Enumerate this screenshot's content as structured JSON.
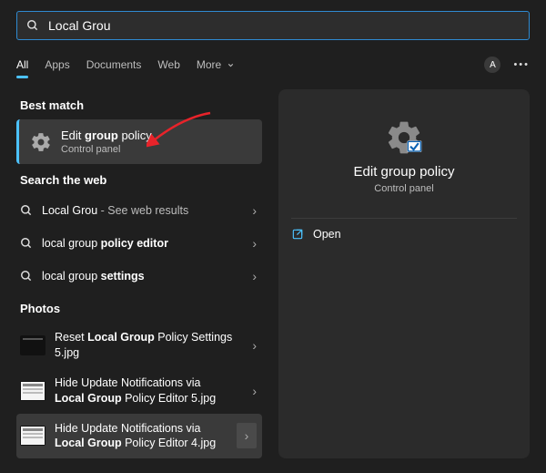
{
  "search": {
    "value": "Local Grou"
  },
  "tabs": {
    "all": "All",
    "apps": "Apps",
    "documents": "Documents",
    "web": "Web",
    "more": "More"
  },
  "avatar_letter": "A",
  "sections": {
    "best_match": "Best match",
    "search_web": "Search the web",
    "photos": "Photos"
  },
  "best_match": {
    "title_pre": "Edit ",
    "title_bold": "group",
    "title_post": " policy",
    "subtitle": "Control panel"
  },
  "web_results": [
    {
      "pre": "Local Grou",
      "bold": "",
      "post": "",
      "suffix": " - See web results"
    },
    {
      "pre": "local group ",
      "bold": "policy editor",
      "post": "",
      "suffix": ""
    },
    {
      "pre": "local group ",
      "bold": "settings",
      "post": "",
      "suffix": ""
    }
  ],
  "photos": [
    {
      "line1_pre": "Reset ",
      "line1_bold": "Local Group",
      "line1_post": " Policy Settings",
      "line2": "5.jpg"
    },
    {
      "line1_pre": "Hide Update Notifications via",
      "line1_bold": "",
      "line1_post": "",
      "line2_pre": "",
      "line2_bold": "Local Group",
      "line2_post": " Policy Editor 5.jpg"
    },
    {
      "line1_pre": "Hide Update Notifications via",
      "line1_bold": "",
      "line1_post": "",
      "line2_pre": "",
      "line2_bold": "Local Group",
      "line2_post": " Policy Editor 4.jpg"
    }
  ],
  "right_panel": {
    "title": "Edit group policy",
    "subtitle": "Control panel",
    "open": "Open"
  }
}
